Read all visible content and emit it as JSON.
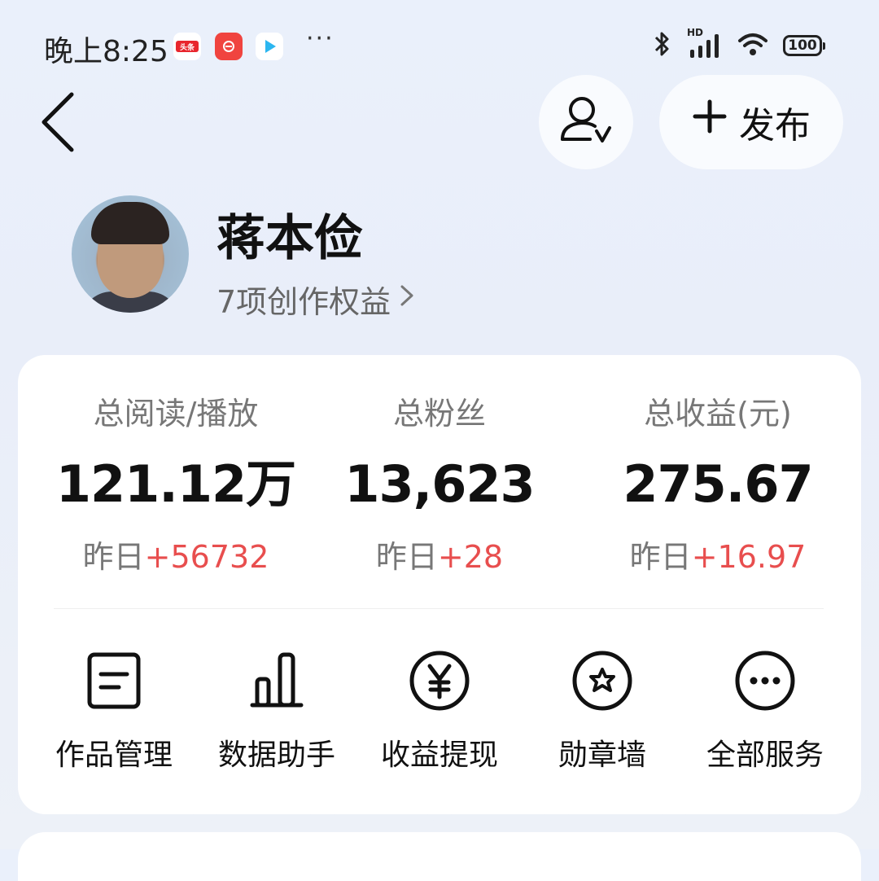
{
  "status_bar": {
    "time": "晚上8:25",
    "more": "···",
    "network_label": "HD",
    "battery": "100",
    "icons": [
      "toutiao-icon",
      "red-app-icon",
      "video-play-icon",
      "bluetooth-icon",
      "signal-icon",
      "wifi-icon",
      "battery-icon"
    ]
  },
  "header": {
    "publish_label": "发布"
  },
  "profile": {
    "name": "蒋本俭",
    "benefits_label": "7项创作权益"
  },
  "stats": [
    {
      "label": "总阅读/播放",
      "value": "121.12万",
      "delta_prefix": "昨日",
      "delta": "+56732"
    },
    {
      "label": "总粉丝",
      "value": "13,623",
      "delta_prefix": "昨日",
      "delta": "+28"
    },
    {
      "label": "总收益(元)",
      "value": "275.67",
      "delta_prefix": "昨日",
      "delta": "+16.97"
    }
  ],
  "tools": [
    {
      "label": "作品管理",
      "icon": "document-icon"
    },
    {
      "label": "数据助手",
      "icon": "bar-chart-icon"
    },
    {
      "label": "收益提现",
      "icon": "yuan-coin-icon"
    },
    {
      "label": "勋章墙",
      "icon": "medal-star-icon"
    },
    {
      "label": "全部服务",
      "icon": "more-services-icon"
    }
  ],
  "colors": {
    "accent_red": "#e84e4e",
    "background": "#eaf0fb",
    "card": "#ffffff"
  }
}
